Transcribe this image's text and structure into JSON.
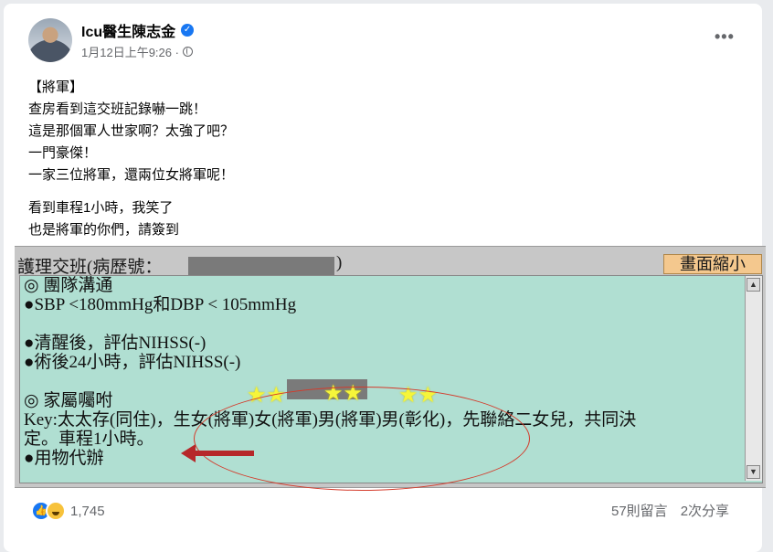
{
  "post": {
    "author": "Icu醫生陳志金",
    "timestamp": "1月12日上午9:26 ·",
    "lines": [
      "【將軍】",
      "查房看到這交班記錄嚇一跳！",
      "這是那個軍人世家啊？太強了吧？",
      "一門豪傑！",
      "一家三位將軍，還兩位女將軍呢！"
    ],
    "lines2": [
      "看到車程1小時，我笑了",
      "也是將軍的你們，請簽到"
    ]
  },
  "screenshot": {
    "title": "護理交班(病歷號：",
    "title_close": ")",
    "zoom_button": "畫面縮小",
    "content": [
      "◎ 團隊溝通",
      "●SBP <180mmHg和DBP < 105mmHg",
      "",
      "●清醒後，評估NIHSS(-)",
      "●術後24小時，評估NIHSS(-)",
      "",
      "◎ 家屬囑咐",
      "Key:太太存(同住)，生女(將軍)女(將軍)男(將軍)男(彰化)，先聯絡二女兒，共同決",
      "定。車程1小時。",
      "●用物代辦"
    ],
    "stars": [
      "★★",
      "★★",
      "★★"
    ]
  },
  "footer": {
    "reaction_count": "1,745",
    "comments": "57則留言",
    "shares": "2次分享"
  },
  "colors": {
    "panel_bg": "#b0dfd2",
    "annotation_red": "#d43a2a",
    "facebook_blue": "#1877f2"
  }
}
